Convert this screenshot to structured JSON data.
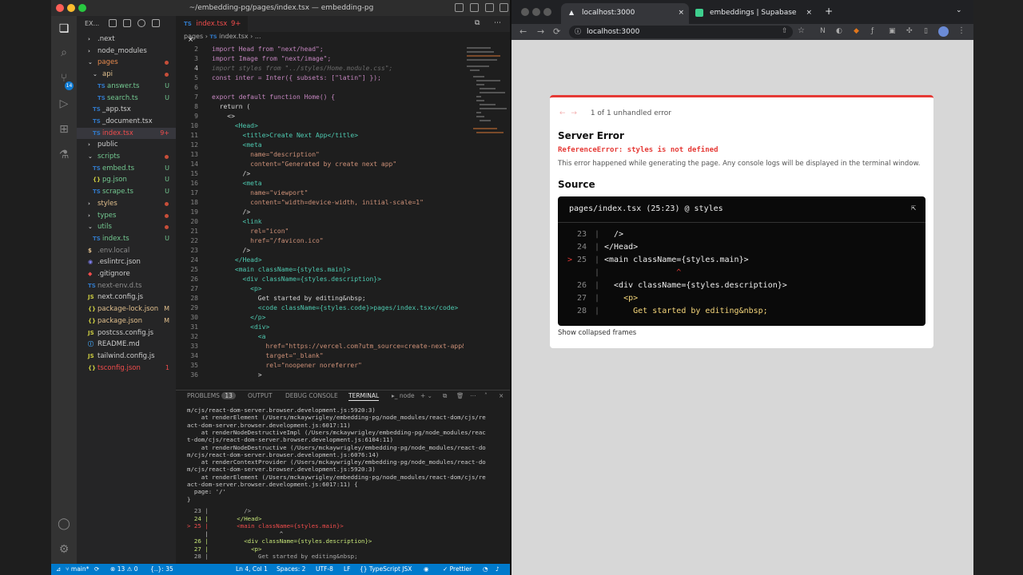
{
  "vscode": {
    "window_title": "~/embedding-pg/pages/index.tsx — embedding-pg",
    "explorer_title": "EX...",
    "scm_badge": "14",
    "file_tree": [
      {
        "label": ".next",
        "indent": 1,
        "kind": "folder",
        "status": ""
      },
      {
        "label": "node_modules",
        "indent": 1,
        "kind": "folder",
        "status": ""
      },
      {
        "label": "pages",
        "indent": 1,
        "kind": "folder-open",
        "status": "dot",
        "color": "#e78a4e"
      },
      {
        "label": "api",
        "indent": 2,
        "kind": "folder-open",
        "status": "dot",
        "color": "#e2c08d"
      },
      {
        "label": "answer.ts",
        "indent": 3,
        "kind": "ts",
        "status": "U",
        "color": "#73c991"
      },
      {
        "label": "search.ts",
        "indent": 3,
        "kind": "ts",
        "status": "U",
        "color": "#73c991"
      },
      {
        "label": "_app.tsx",
        "indent": 2,
        "kind": "ts",
        "status": "",
        "color": "#ccc"
      },
      {
        "label": "_document.tsx",
        "indent": 2,
        "kind": "ts",
        "status": "",
        "color": "#ccc"
      },
      {
        "label": "index.tsx",
        "indent": 2,
        "kind": "ts",
        "status": "9+",
        "color": "#f14c4c"
      },
      {
        "label": "public",
        "indent": 1,
        "kind": "folder",
        "status": "",
        "color": "#ccc"
      },
      {
        "label": "scripts",
        "indent": 1,
        "kind": "folder-open",
        "status": "dot",
        "color": "#73c991"
      },
      {
        "label": "embed.ts",
        "indent": 2,
        "kind": "ts",
        "status": "U",
        "color": "#73c991"
      },
      {
        "label": "pg.json",
        "indent": 2,
        "kind": "json",
        "status": "U",
        "color": "#73c991"
      },
      {
        "label": "scrape.ts",
        "indent": 2,
        "kind": "ts",
        "status": "U",
        "color": "#73c991"
      },
      {
        "label": "styles",
        "indent": 1,
        "kind": "folder",
        "status": "dot",
        "color": "#e2c08d"
      },
      {
        "label": "types",
        "indent": 1,
        "kind": "folder",
        "status": "dot",
        "color": "#73c991"
      },
      {
        "label": "utils",
        "indent": 1,
        "kind": "folder-open",
        "status": "dot",
        "color": "#73c991"
      },
      {
        "label": "index.ts",
        "indent": 2,
        "kind": "ts",
        "status": "U",
        "color": "#73c991"
      },
      {
        "label": ".env.local",
        "indent": 1,
        "kind": "env",
        "status": "",
        "color": "#8c8c8c"
      },
      {
        "label": ".eslintrc.json",
        "indent": 1,
        "kind": "eslint",
        "status": "",
        "color": "#ccc"
      },
      {
        "label": ".gitignore",
        "indent": 1,
        "kind": "git",
        "status": "",
        "color": "#ccc"
      },
      {
        "label": "next-env.d.ts",
        "indent": 1,
        "kind": "ts",
        "status": "",
        "color": "#8c8c8c"
      },
      {
        "label": "next.config.js",
        "indent": 1,
        "kind": "js",
        "status": "",
        "color": "#ccc"
      },
      {
        "label": "package-lock.json",
        "indent": 1,
        "kind": "json",
        "status": "M",
        "color": "#e2c08d"
      },
      {
        "label": "package.json",
        "indent": 1,
        "kind": "json",
        "status": "M",
        "color": "#e2c08d"
      },
      {
        "label": "postcss.config.js",
        "indent": 1,
        "kind": "js",
        "status": "",
        "color": "#ccc"
      },
      {
        "label": "README.md",
        "indent": 1,
        "kind": "md",
        "status": "",
        "color": "#ccc"
      },
      {
        "label": "tailwind.config.js",
        "indent": 1,
        "kind": "js",
        "status": "",
        "color": "#ccc"
      },
      {
        "label": "tsconfig.json",
        "indent": 1,
        "kind": "json",
        "status": "1",
        "color": "#f14c4c"
      }
    ],
    "tab_label": "index.tsx",
    "tab_status": "9+",
    "breadcrumb": [
      "pages",
      "index.tsx",
      "..."
    ],
    "code_lines": [
      {
        "n": "2",
        "t": "import Head from \"next/head\";"
      },
      {
        "n": "3",
        "t": "import Image from \"next/image\";"
      },
      {
        "n": "4",
        "t": "import styles from \"../styles/Home.module.css\";",
        "dim": true
      },
      {
        "n": "5",
        "t": "const inter = Inter({ subsets: [\"latin\"] });"
      },
      {
        "n": "6",
        "t": ""
      },
      {
        "n": "7",
        "t": "export default function Home() {"
      },
      {
        "n": "8",
        "t": "  return ("
      },
      {
        "n": "9",
        "t": "    <>"
      },
      {
        "n": "10",
        "t": "      <Head>"
      },
      {
        "n": "11",
        "t": "        <title>Create Next App</title>"
      },
      {
        "n": "12",
        "t": "        <meta"
      },
      {
        "n": "13",
        "t": "          name=\"description\""
      },
      {
        "n": "14",
        "t": "          content=\"Generated by create next app\""
      },
      {
        "n": "15",
        "t": "        />"
      },
      {
        "n": "16",
        "t": "        <meta"
      },
      {
        "n": "17",
        "t": "          name=\"viewport\""
      },
      {
        "n": "18",
        "t": "          content=\"width=device-width, initial-scale=1\""
      },
      {
        "n": "19",
        "t": "        />"
      },
      {
        "n": "20",
        "t": "        <link"
      },
      {
        "n": "21",
        "t": "          rel=\"icon\""
      },
      {
        "n": "22",
        "t": "          href=\"/favicon.ico\""
      },
      {
        "n": "23",
        "t": "        />"
      },
      {
        "n": "24",
        "t": "      </Head>"
      },
      {
        "n": "25",
        "t": "      <main className={styles.main}>"
      },
      {
        "n": "26",
        "t": "        <div className={styles.description}>"
      },
      {
        "n": "27",
        "t": "          <p>"
      },
      {
        "n": "28",
        "t": "            Get started by editing&nbsp;"
      },
      {
        "n": "29",
        "t": "            <code className={styles.code}>pages/index.tsx</code>"
      },
      {
        "n": "30",
        "t": "          </p>"
      },
      {
        "n": "31",
        "t": "          <div>"
      },
      {
        "n": "32",
        "t": "            <a"
      },
      {
        "n": "33",
        "t": "              href=\"https://vercel.com?utm_source=create-next-app&"
      },
      {
        "n": "34",
        "t": "              target=\"_blank\""
      },
      {
        "n": "35",
        "t": "              rel=\"noopener noreferrer\""
      },
      {
        "n": "36",
        "t": "            >"
      }
    ],
    "panel_tabs": {
      "problems": "PROBLEMS",
      "problems_count": "13",
      "output": "OUTPUT",
      "debug": "DEBUG CONSOLE",
      "terminal": "TERMINAL",
      "shell": "node"
    },
    "terminal_lines": [
      "m/cjs/react-dom-server.browser.development.js:5920:3)",
      "    at renderElement (/Users/mckaywrigley/embedding-pg/node_modules/react-dom/cjs/re",
      "act-dom-server.browser.development.js:6017:11)",
      "    at renderNodeDestructiveImpl (/Users/mckaywrigley/embedding-pg/node_modules/reac",
      "t-dom/cjs/react-dom-server.browser.development.js:6104:11)",
      "    at renderNodeDestructive (/Users/mckaywrigley/embedding-pg/node_modules/react-do",
      "m/cjs/react-dom-server.browser.development.js:6076:14)",
      "    at renderContextProvider (/Users/mckaywrigley/embedding-pg/node_modules/react-do",
      "m/cjs/react-dom-server.browser.development.js:5920:3)",
      "    at renderElement (/Users/mckaywrigley/embedding-pg/node_modules/react-dom/cjs/re",
      "act-dom-server.browser.development.js:6017:11) {",
      "  page: '/'",
      "}",
      "  23 |          />",
      "  24 |        </Head>",
      "> 25 |        <main className={styles.main}>",
      "     |                    ^",
      "  26 |          <div className={styles.description}>",
      "  27 |            <p>",
      "  28 |              Get started by editing&nbsp;",
      "▯"
    ],
    "status": {
      "branch": "main*",
      "errors": "13",
      "warnings": "0",
      "other": "{..}: 35",
      "position": "Ln 4, Col 1",
      "spaces": "Spaces: 2",
      "encoding": "UTF-8",
      "eol": "LF",
      "language": "{} TypeScript JSX",
      "formatter": "✓ Prettier"
    }
  },
  "browser": {
    "tabs": [
      {
        "label": "localhost:3000",
        "active": true
      },
      {
        "label": "embeddings | Supabase",
        "active": false
      }
    ],
    "url": "localhost:3000",
    "error": {
      "counter": "1 of 1 unhandled error",
      "title": "Server Error",
      "reference": "ReferenceError: styles is not defined",
      "message": "This error happened while generating the page. Any console logs will be displayed in the terminal window.",
      "source_heading": "Source",
      "source_file": "pages/index.tsx (25:23) @ styles",
      "source_lines": [
        {
          "marker": "",
          "n": "23",
          "t": "  />"
        },
        {
          "marker": "",
          "n": "24",
          "t": "</Head>"
        },
        {
          "marker": ">",
          "n": "25",
          "t": "<main className={styles.main}>"
        },
        {
          "marker": "",
          "n": "",
          "t": "               ^"
        },
        {
          "marker": "",
          "n": "26",
          "t": "  <div className={styles.description}>"
        },
        {
          "marker": "",
          "n": "27",
          "t": "    <p>"
        },
        {
          "marker": "",
          "n": "28",
          "t": "      Get started by editing&nbsp;"
        }
      ],
      "collapse_label": "Show collapsed frames"
    }
  }
}
